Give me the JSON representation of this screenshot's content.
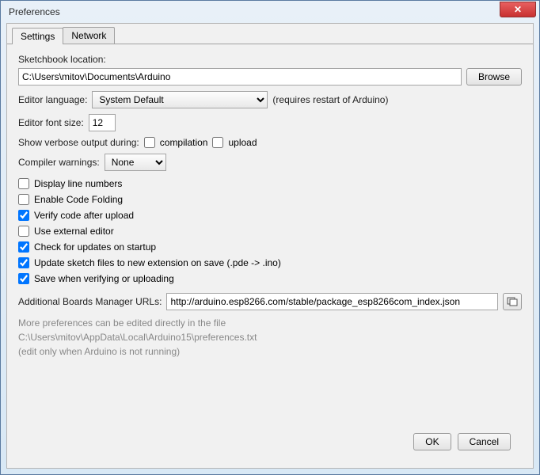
{
  "window": {
    "title": "Preferences"
  },
  "tabs": {
    "settings": "Settings",
    "network": "Network"
  },
  "sketchbook": {
    "label": "Sketchbook location:",
    "value": "C:\\Users\\mitov\\Documents\\Arduino",
    "browse": "Browse"
  },
  "language": {
    "label": "Editor language:",
    "value": "System Default",
    "hint": "(requires restart of Arduino)"
  },
  "fontsize": {
    "label": "Editor font size:",
    "value": "12"
  },
  "verbose": {
    "label": "Show verbose output during:",
    "compilation": "compilation",
    "upload": "upload"
  },
  "warnings": {
    "label": "Compiler warnings:",
    "value": "None"
  },
  "options": {
    "line_numbers": "Display line numbers",
    "code_folding": "Enable Code Folding",
    "verify_upload": "Verify code after upload",
    "external_editor": "Use external editor",
    "check_updates": "Check for updates on startup",
    "update_sketch": "Update sketch files to new extension on save (.pde -> .ino)",
    "save_verify": "Save when verifying or uploading"
  },
  "boards": {
    "label": "Additional Boards Manager URLs:",
    "value": "http://arduino.esp8266.com/stable/package_esp8266com_index.json"
  },
  "notes": {
    "line1": "More preferences can be edited directly in the file",
    "line2": "C:\\Users\\mitov\\AppData\\Local\\Arduino15\\preferences.txt",
    "line3": "(edit only when Arduino is not running)"
  },
  "buttons": {
    "ok": "OK",
    "cancel": "Cancel"
  }
}
